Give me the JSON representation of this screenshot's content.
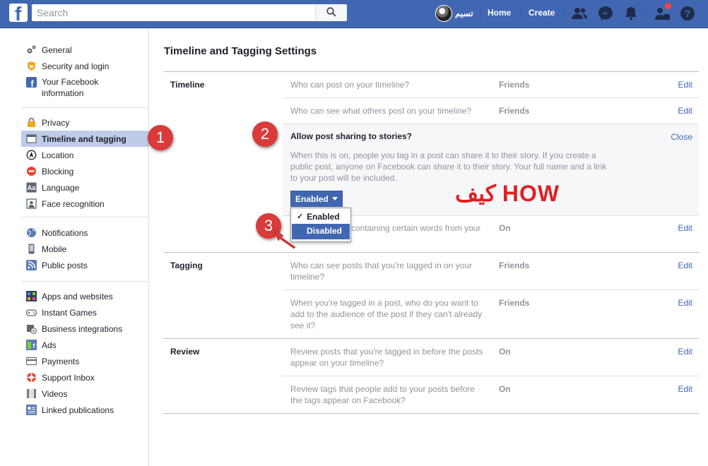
{
  "topbar": {
    "logo": "f",
    "search_placeholder": "Search",
    "profile_name": "تسيم",
    "nav": [
      "Home",
      "Create"
    ],
    "icons": [
      "friends-icon",
      "messenger-icon",
      "notifications-icon",
      "friend-requests-icon",
      "help-icon"
    ],
    "brand_color": "#4267b2"
  },
  "sidebar": {
    "group1": [
      {
        "label": "General",
        "icon": "gear-icon"
      },
      {
        "label": "Security and login",
        "icon": "shield-icon"
      },
      {
        "label": "Your Facebook information",
        "icon": "facebook-icon"
      }
    ],
    "group2": [
      {
        "label": "Privacy",
        "icon": "lock-icon"
      },
      {
        "label": "Timeline and tagging",
        "icon": "timeline-icon",
        "active": true
      },
      {
        "label": "Location",
        "icon": "location-icon"
      },
      {
        "label": "Blocking",
        "icon": "blocking-icon"
      },
      {
        "label": "Language",
        "icon": "language-icon"
      },
      {
        "label": "Face recognition",
        "icon": "face-recognition-icon"
      }
    ],
    "group3": [
      {
        "label": "Notifications",
        "icon": "globe-icon"
      },
      {
        "label": "Mobile",
        "icon": "mobile-icon"
      },
      {
        "label": "Public posts",
        "icon": "rss-icon"
      }
    ],
    "group4": [
      {
        "label": "Apps and websites",
        "icon": "apps-icon"
      },
      {
        "label": "Instant Games",
        "icon": "gamepad-icon"
      },
      {
        "label": "Business integrations",
        "icon": "business-icon"
      },
      {
        "label": "Ads",
        "icon": "ads-icon"
      },
      {
        "label": "Payments",
        "icon": "card-icon"
      },
      {
        "label": "Support Inbox",
        "icon": "support-icon"
      },
      {
        "label": "Videos",
        "icon": "video-icon"
      },
      {
        "label": "Linked publications",
        "icon": "publications-icon"
      }
    ]
  },
  "main": {
    "title": "Timeline and Tagging Settings",
    "sections": {
      "timeline": "Timeline",
      "tagging": "Tagging",
      "review": "Review"
    },
    "rows": {
      "r1": {
        "q": "Who can post on your timeline?",
        "v": "Friends",
        "action": "Edit"
      },
      "r2": {
        "q": "Who can see what others post on your timeline?",
        "v": "Friends",
        "action": "Edit"
      },
      "r3": {
        "q": "containing certain words from your",
        "v": "On",
        "action": "Edit"
      },
      "r4": {
        "q": "Who can see posts that you're tagged in on your timeline?",
        "v": "Friends",
        "action": "Edit"
      },
      "r5": {
        "q": "When you're tagged in a post, who do you want to add to the audience of the post if they can't already see it?",
        "v": "Friends",
        "action": "Edit"
      },
      "r6": {
        "q": "Review posts that you're tagged in before the posts appear on your timeline?",
        "v": "On",
        "action": "Edit"
      },
      "r7": {
        "q": "Review tags that people add to your posts before the tags appear on Facebook?",
        "v": "On",
        "action": "Edit"
      }
    },
    "expanded": {
      "title": "Allow post sharing to stories?",
      "close": "Close",
      "description": "When this is on, people you tag in a post can share it to their story. If you create a public post, anyone on Facebook can share it to their story. Your full name and a link to your post will be included.",
      "selected": "Enabled",
      "options": [
        "Enabled",
        "Disabled"
      ],
      "checked_option": "Enabled",
      "highlighted_option": "Disabled"
    }
  },
  "annotations": {
    "badges": [
      "1",
      "2",
      "3"
    ],
    "overlay_text": "كيف HOW",
    "color": "#d93a3a"
  }
}
